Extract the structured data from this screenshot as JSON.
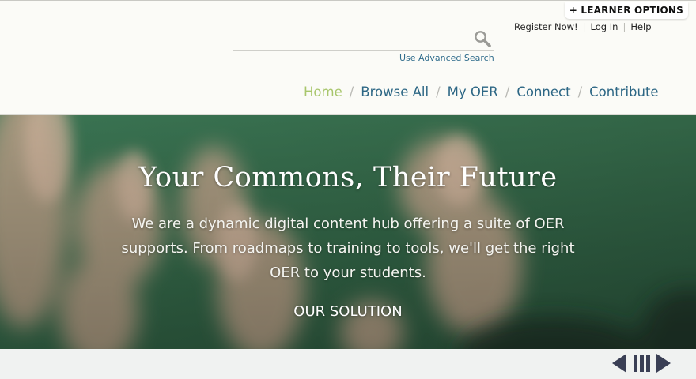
{
  "header": {
    "learner_options": "+ LEARNER OPTIONS",
    "user_links": [
      "Register Now!",
      "Log In",
      "Help"
    ],
    "search": {
      "value": "",
      "placeholder": "",
      "advanced_link": "Use Advanced Search"
    },
    "nav": [
      {
        "label": "Home",
        "active": true
      },
      {
        "label": "Browse All",
        "active": false
      },
      {
        "label": "My OER",
        "active": false
      },
      {
        "label": "Connect",
        "active": false
      },
      {
        "label": "Contribute",
        "active": false
      }
    ]
  },
  "hero": {
    "title": "Your Commons, Their Future",
    "description": "We are a dynamic digital content hub offering a suite of OER supports. From roadmaps to training to tools, we'll get the right OER to your students.",
    "cta": "OUR SOLUTION"
  },
  "slider": {
    "controls": [
      "prev-icon",
      "pause-icon",
      "next-icon"
    ]
  },
  "colors": {
    "nav_link": "#2d6785",
    "nav_active": "#a8c66c",
    "hero_green": "#3f7354",
    "control": "#3a3f55"
  }
}
